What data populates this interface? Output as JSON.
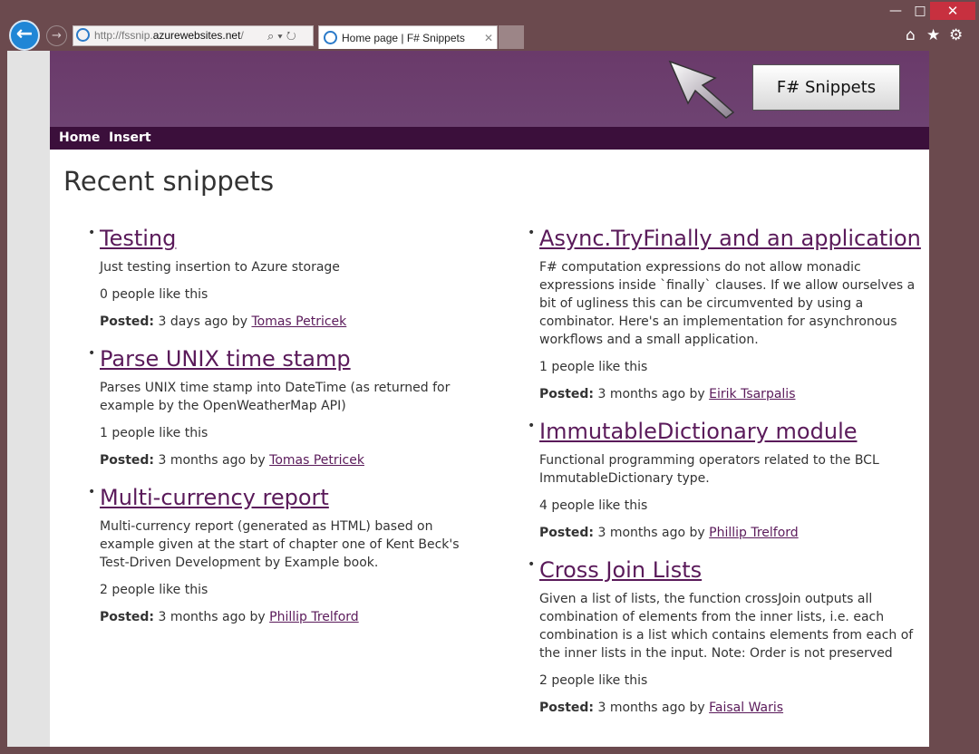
{
  "browser": {
    "url_prefix": "http://fssnip.",
    "url_domain": "azurewebsites.net",
    "url_suffix": "/",
    "tab_title": "Home page | F# Snippets",
    "minimize": "—",
    "maximize": "□",
    "close": "✕"
  },
  "site": {
    "logo": "F# Snippets",
    "nav": {
      "home": "Home",
      "insert": "Insert"
    },
    "page_title": "Recent snippets",
    "posted_label": "Posted:"
  },
  "snippets_left": [
    {
      "title": "Testing",
      "description": "Just testing insertion to Azure storage",
      "likes": "0 people like this",
      "when": "3 days ago by",
      "author": "Tomas Petricek"
    },
    {
      "title": "Parse UNIX time stamp",
      "description": "Parses UNIX time stamp into DateTime (as returned for example by the OpenWeatherMap API)",
      "likes": "1 people like this",
      "when": "3 months ago by",
      "author": "Tomas Petricek"
    },
    {
      "title": "Multi-currency report",
      "description": "Multi-currency report (generated as HTML) based on example given at the start of chapter one of Kent Beck's Test-Driven Development by Example book.",
      "likes": "2 people like this",
      "when": "3 months ago by",
      "author": "Phillip Trelford"
    }
  ],
  "snippets_right": [
    {
      "title": "Async.TryFinally and an application",
      "description": "F# computation expressions do not allow monadic expressions inside `finally` clauses. If we allow ourselves a bit of ugliness this can be circumvented by using a combinator. Here's an implementation for asynchronous workflows and a small application.",
      "likes": "1 people like this",
      "when": "3 months ago by",
      "author": "Eirik Tsarpalis"
    },
    {
      "title": "ImmutableDictionary module",
      "description": "Functional programming operators related to the BCL ImmutableDictionary type.",
      "likes": "4 people like this",
      "when": "3 months ago by",
      "author": "Phillip Trelford"
    },
    {
      "title": "Cross Join Lists",
      "description": "Given a list of lists, the function crossJoin outputs all combination of elements from the inner lists, i.e. each combination is a list which contains elements from each of the inner lists in the input. Note: Order is not preserved",
      "likes": "2 people like this",
      "when": "3 months ago by",
      "author": "Faisal Waris"
    }
  ]
}
